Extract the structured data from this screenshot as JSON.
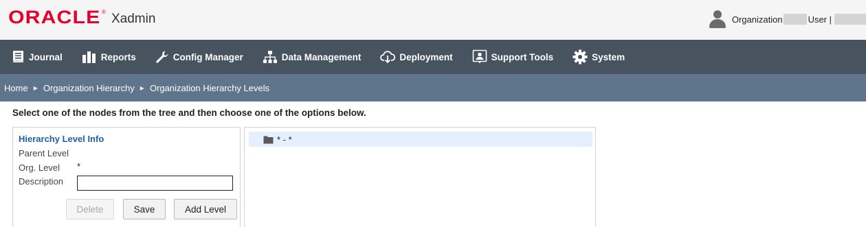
{
  "header": {
    "logo_text": "ORACLE",
    "logo_mark": "®",
    "app_name": "Xadmin",
    "user_prefix": "Organization",
    "user_label": "User |",
    "user_icon": "user-icon"
  },
  "nav": {
    "items": [
      {
        "label": "Journal",
        "icon": "journal-icon"
      },
      {
        "label": "Reports",
        "icon": "reports-icon"
      },
      {
        "label": "Config Manager",
        "icon": "wrench-icon"
      },
      {
        "label": "Data Management",
        "icon": "hierarchy-icon"
      },
      {
        "label": "Deployment",
        "icon": "cloud-download-icon"
      },
      {
        "label": "Support Tools",
        "icon": "support-icon"
      },
      {
        "label": "System",
        "icon": "gear-icon"
      }
    ]
  },
  "breadcrumb": [
    "Home",
    "Organization Hierarchy",
    "Organization Hierarchy Levels"
  ],
  "instructions": "Select one of the nodes from the tree and then choose one of the options below.",
  "info": {
    "title": "Hierarchy Level Info",
    "parent_label": "Parent Level",
    "parent_value": "",
    "org_label": "Org. Level",
    "org_value": "*",
    "description_label": "Description",
    "description_value": ""
  },
  "buttons": {
    "delete": "Delete",
    "save": "Save",
    "add_level": "Add Level"
  },
  "tree": {
    "nodes": [
      {
        "label": "* - *",
        "icon": "folder-icon",
        "selected": true
      }
    ]
  },
  "colors": {
    "brand": "#e4002b",
    "nav_bg": "#47535e",
    "breadcrumb_bg": "#5e758b",
    "link": "#1f5fa8",
    "tree_selected": "#e4f0fb"
  }
}
